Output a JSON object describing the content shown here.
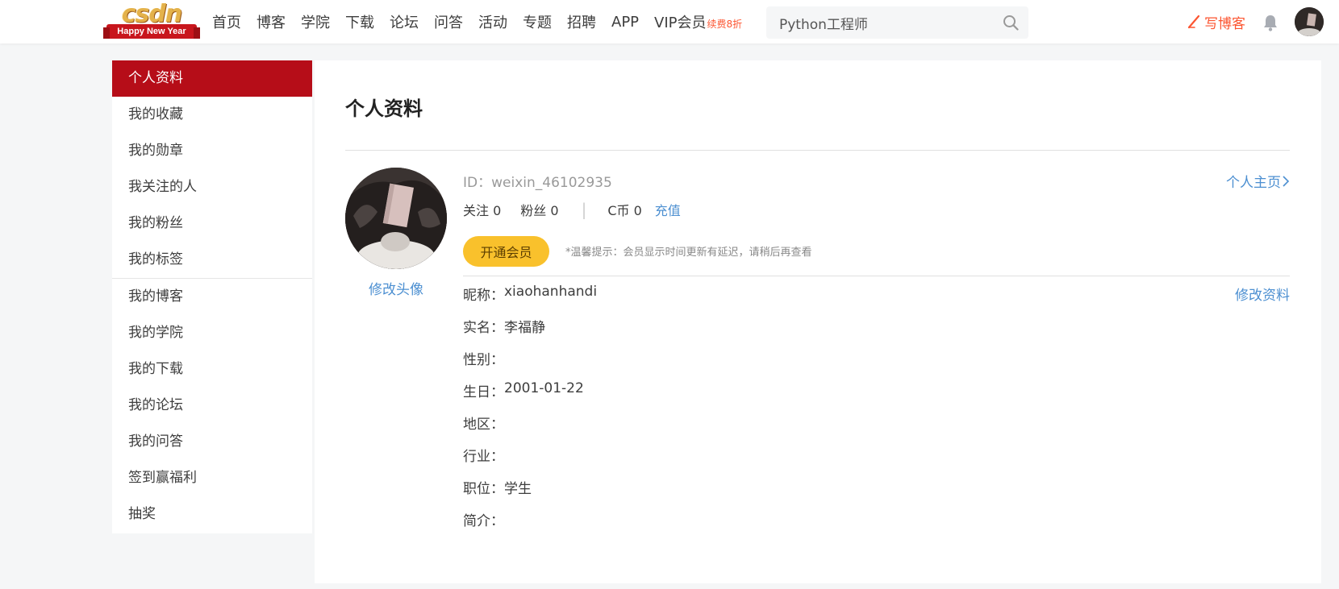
{
  "logo": {
    "word": "csdn",
    "ribbon": "Happy New Year"
  },
  "nav": {
    "items": [
      "首页",
      "博客",
      "学院",
      "下载",
      "论坛",
      "问答",
      "活动",
      "专题",
      "招聘",
      "APP"
    ],
    "vip_label": "VIP会员",
    "vip_badge": "续费8折"
  },
  "search": {
    "value": "Python工程师",
    "icon": "search-icon"
  },
  "header": {
    "write_blog": "写博客",
    "bell_icon": "bell-icon"
  },
  "sidebar": {
    "items": [
      "个人资料",
      "我的收藏",
      "我的勋章",
      "我关注的人",
      "我的粉丝",
      "我的标签",
      "我的博客",
      "我的学院",
      "我的下载",
      "我的论坛",
      "我的问答",
      "签到赢福利",
      "抽奖"
    ],
    "active_index": 0
  },
  "profile": {
    "title": "个人资料",
    "change_avatar": "修改头像",
    "id_text": "ID：weixin_46102935",
    "home_link": "个人主页",
    "follow": "关注 0",
    "fans": "粉丝 0",
    "separator": "|",
    "coins": "C币 0",
    "recharge": "充值",
    "vip_button": "开通会员",
    "vip_tip": "*温馨提示：会员显示时间更新有延迟，请稍后再查看",
    "edit": "修改资料",
    "fields": [
      {
        "label": "昵称：",
        "value": "xiaohanhandi"
      },
      {
        "label": "实名：",
        "value": "李福静"
      },
      {
        "label": "性别：",
        "value": ""
      },
      {
        "label": "生日：",
        "value": "2001-01-22"
      },
      {
        "label": "地区：",
        "value": ""
      },
      {
        "label": "行业：",
        "value": ""
      },
      {
        "label": "职位：",
        "value": "学生"
      },
      {
        "label": "简介：",
        "value": ""
      }
    ]
  },
  "colors": {
    "brand_red": "#b60d18",
    "link_blue": "#4c8fd1",
    "vip_yellow": "#f9c12c",
    "accent_orange": "#fc5531"
  }
}
